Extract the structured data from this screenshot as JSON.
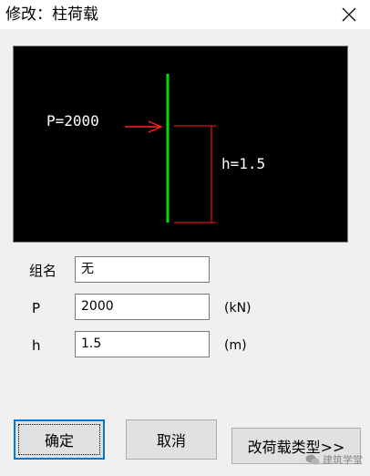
{
  "window": {
    "title": "修改：柱荷载",
    "close_icon": "close-icon"
  },
  "preview": {
    "load_label": "P=2000",
    "height_label": "h=1.5",
    "colors": {
      "column": "#00dd00",
      "arrow": "#ff2020",
      "dimension": "#dd1020",
      "background": "#000000"
    }
  },
  "form": {
    "group_name": {
      "label": "组名",
      "value": "无"
    },
    "p": {
      "label": "P",
      "value": "2000",
      "unit": "(kN)"
    },
    "h": {
      "label": "h",
      "value": "1.5",
      "unit": "(m)"
    }
  },
  "buttons": {
    "ok": "确定",
    "cancel": "取消",
    "change_type": "改荷载类型>>"
  },
  "watermark": {
    "text": "建筑学堂"
  },
  "accent_color": "#0078d7"
}
